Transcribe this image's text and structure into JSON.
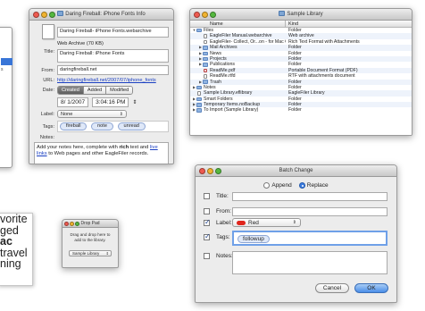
{
  "info_window": {
    "title": "Daring Fireball: iPhone Fonts Info",
    "filename": "Daring Fireball- iPhone Fonts.webarchive",
    "kind_size": "Web Archive (70 KB)",
    "title_label": "Title:",
    "title_value": "Daring Fireball: iPhone Fonts",
    "from_label": "From:",
    "from_value": "daringfireball.net",
    "url_label": "URL:",
    "url_value": "http://daringfireball.net/2007/07/iphone_fonts",
    "date_label": "Date:",
    "date_tabs": [
      "Created",
      "Added",
      "Modified"
    ],
    "date_value": "8/ 1/2007",
    "time_value": "3:04:16 PM",
    "label_label": "Label:",
    "label_value": "None",
    "tags_label": "Tags:",
    "tags": [
      "fireball",
      "note",
      "unread"
    ],
    "notes_label": "Notes:",
    "notes_text_1": "Add your notes here, complete with ",
    "notes_bold": "rich",
    "notes_text_2": " text and ",
    "notes_link": "live links",
    "notes_text_3": " to Web pages and other EagleFiler records."
  },
  "library_window": {
    "title": "Sample Library",
    "col_name": "Name",
    "col_kind": "Kind",
    "rows": [
      {
        "name": "Files",
        "kind": "Folder",
        "icon": "folder",
        "open": true
      },
      {
        "name": "EagleFiler Manual.webarchive",
        "kind": "Web archive",
        "icon": "doc"
      },
      {
        "name": "EagleFiler- Collect, Or...on - for Mac OS X.rtf",
        "kind": "Rich Text Format with Attachments",
        "icon": "doc"
      },
      {
        "name": "Mail Archives",
        "kind": "Folder",
        "icon": "folder",
        "closed": true
      },
      {
        "name": "News",
        "kind": "Folder",
        "icon": "folder",
        "closed": true
      },
      {
        "name": "Projects",
        "kind": "Folder",
        "icon": "folder",
        "closed": true
      },
      {
        "name": "Publications",
        "kind": "Folder",
        "icon": "folder",
        "closed": true
      },
      {
        "name": "ReadMe.pdf",
        "kind": "Portable Document Format (PDF)",
        "icon": "pdf"
      },
      {
        "name": "ReadMe.rtfd",
        "kind": "RTF with attachments document",
        "icon": "doc"
      },
      {
        "name": "Trash",
        "kind": "Folder",
        "icon": "folder",
        "closed": true
      },
      {
        "name": "Notes",
        "kind": "Folder",
        "icon": "folder",
        "top": true
      },
      {
        "name": "Sample Library.eflibrary",
        "kind": "EagleFiler Library",
        "icon": "doc",
        "top": true
      },
      {
        "name": "Smart Folders",
        "kind": "Folder",
        "icon": "folder",
        "top": true
      },
      {
        "name": "Temporary Items.noBackup",
        "kind": "Folder",
        "icon": "folder",
        "top": true
      },
      {
        "name": "To Import (Sample Library)",
        "kind": "Folder",
        "icon": "folder",
        "top": true
      }
    ]
  },
  "batch_window": {
    "title": "Batch Change",
    "append_label": "Append",
    "replace_label": "Replace",
    "title_label": "Title:",
    "from_label": "From:",
    "label_label": "Label:",
    "label_value": "Red",
    "tags_label": "Tags:",
    "tags_value": "followup",
    "notes_label": "Notes:",
    "cancel_label": "Cancel",
    "ok_label": "OK",
    "colors": {
      "red_label": "#e0251c",
      "focus": "#6fa0e8"
    }
  },
  "drop_pad": {
    "title": "Drop Pad",
    "text_1": "Drag and drop here to",
    "text_2": "add to the library.",
    "library_value": "Sample Library"
  },
  "text_fragment": {
    "lines": [
      "vorite",
      "ged",
      "ac",
      "travel",
      "ning"
    ]
  },
  "stub_window": {
    "text": "s"
  }
}
